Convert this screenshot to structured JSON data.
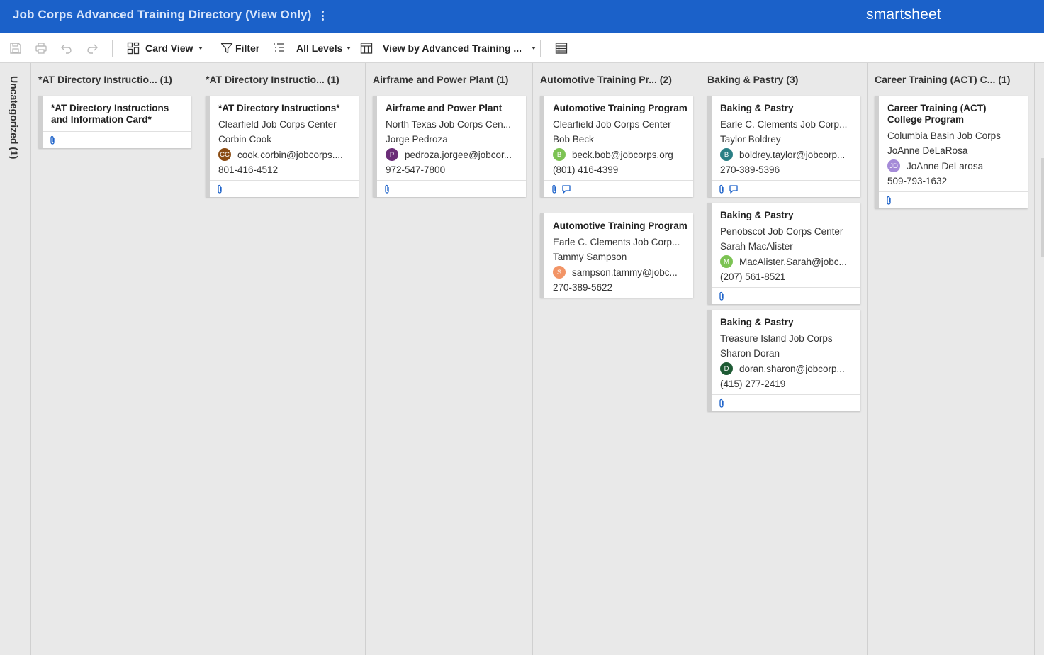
{
  "app": {
    "title": "Job Corps Advanced Training Directory (View Only)",
    "brand": "smartsheet"
  },
  "toolbar": {
    "card_view": "Card View",
    "filter": "Filter",
    "levels": "All Levels",
    "view_by": "View by Advanced Training ..."
  },
  "uncategorized": "Uncategorized (1)",
  "lanes": [
    {
      "title": "*AT Directory Instructio...  (1)",
      "cards": [
        {
          "title": "*AT Directory Instructions and Information Card*"
        }
      ]
    },
    {
      "title": "*AT Directory Instructio...  (1)",
      "cards": [
        {
          "title": "*AT Directory Instructions*",
          "center": "Clearfield Job Corps Center",
          "name": "Corbin Cook",
          "initials": "CC",
          "email": "cook.corbin@jobcorps....",
          "phone": "801-416-4512"
        }
      ]
    },
    {
      "title": "Airframe and Power Plant (1)",
      "cards": [
        {
          "title": "Airframe and Power Plant",
          "center": "North Texas Job Corps Cen...",
          "name": "Jorge Pedroza",
          "initials": "P",
          "email": "pedroza.jorgee@jobcor...",
          "phone": "972-547-7800"
        }
      ]
    },
    {
      "title": "Automotive Training Pr...  (2)",
      "cards": [
        {
          "title": "Automotive Training Program",
          "center": "Clearfield Job Corps Center",
          "name": "Bob Beck",
          "initials": "B",
          "email": "beck.bob@jobcorps.org",
          "phone": "(801) 416-4399"
        },
        {
          "title": "Automotive Training Program",
          "center": "Earle C. Clements Job Corp...",
          "name": "Tammy Sampson",
          "initials": "S",
          "email": "sampson.tammy@jobc...",
          "phone": "270-389-5622"
        }
      ]
    },
    {
      "title": "Baking & Pastry (3)",
      "cards": [
        {
          "title": "Baking & Pastry",
          "center": "Earle C. Clements Job Corp...",
          "name": "Taylor Boldrey",
          "initials": "B",
          "email": "boldrey.taylor@jobcorp...",
          "phone": "270-389-5396"
        },
        {
          "title": "Baking & Pastry",
          "center": "Penobscot Job Corps Center",
          "name": "Sarah MacAlister",
          "initials": "M",
          "email": "MacAlister.Sarah@jobc...",
          "phone": "(207) 561-8521"
        },
        {
          "title": "Baking & Pastry",
          "center": "Treasure Island Job Corps",
          "name": "Sharon Doran",
          "initials": "D",
          "email": "doran.sharon@jobcorp...",
          "phone": "(415) 277-2419"
        }
      ]
    },
    {
      "title": "Career Training (ACT) C... (1)",
      "cards": [
        {
          "title": "Career Training (ACT) College Program",
          "center": "Columbia Basin Job Corps",
          "name": "JoAnne DeLaRosa",
          "initials": "JD",
          "email": "JoAnne DeLarosa",
          "phone": "509-793-1632"
        }
      ]
    }
  ],
  "colors": {
    "header_blue": "#1b61c9",
    "icon_blue": "#1b61c9",
    "avatar_cc": "#8a4b12",
    "avatar_p": "#6b2d78",
    "avatar_beck": "#7cc353",
    "avatar_sampson": "#f29466",
    "avatar_boldrey": "#2a7f85",
    "avatar_macalister": "#7cc353",
    "avatar_doran": "#1e5b34",
    "avatar_jd": "#a58bd8"
  }
}
